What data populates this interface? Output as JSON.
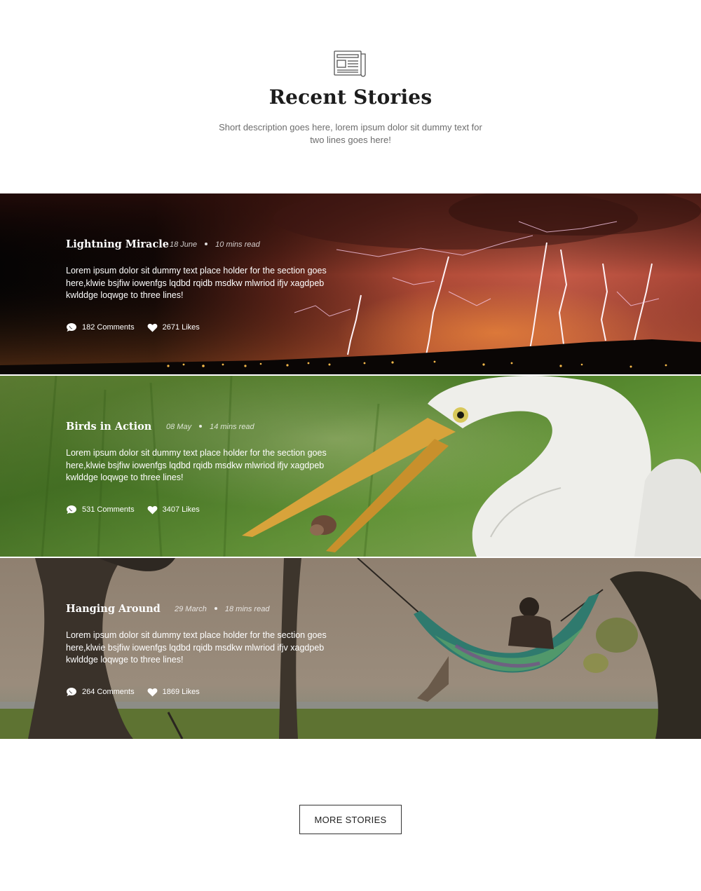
{
  "header": {
    "icon": "newspaper-icon",
    "title": "Recent Stories",
    "description": "Short description goes here, lorem ipsum dolor sit dummy text for two lines goes here!"
  },
  "stories": [
    {
      "title": "Lightning Miracle",
      "date": "18 June",
      "read_time": "10 mins read",
      "excerpt": "Lorem ipsum dolor sit dummy text place holder for the section goes here,klwie bsjfiw iowenfgs lqdbd rqidb msdkw mlwriod ifjv xagdpeb kwlddge loqwge to three lines!",
      "comments": "182 Comments",
      "likes": "2671 Likes",
      "image": "lightning-storm-photo"
    },
    {
      "title": "Birds in Action",
      "date": "08 May",
      "read_time": "14 mins read",
      "excerpt": "Lorem ipsum dolor sit dummy text place holder for the section goes here,klwie bsjfiw iowenfgs lqdbd rqidb msdkw mlwriod ifjv xagdpeb kwlddge loqwge to three lines!",
      "comments": "531 Comments",
      "likes": "3407 Likes",
      "image": "egret-photo"
    },
    {
      "title": "Hanging Around",
      "date": "29 March",
      "read_time": "18 mins read",
      "excerpt": "Lorem ipsum dolor sit dummy text place holder for the section goes here,klwie bsjfiw iowenfgs lqdbd rqidb msdkw mlwriod ifjv xagdpeb kwlddge loqwge to three lines!",
      "comments": "264 Comments",
      "likes": "1869 Likes",
      "image": "hammock-photo"
    }
  ],
  "more_button": "MORE STORIES",
  "icons": {
    "comment": "comment-bubble-icon",
    "like": "heart-icon"
  },
  "colors": {
    "text": "#1c1c1c",
    "muted": "#6d6d6d",
    "overlay_text": "#ffffff"
  }
}
